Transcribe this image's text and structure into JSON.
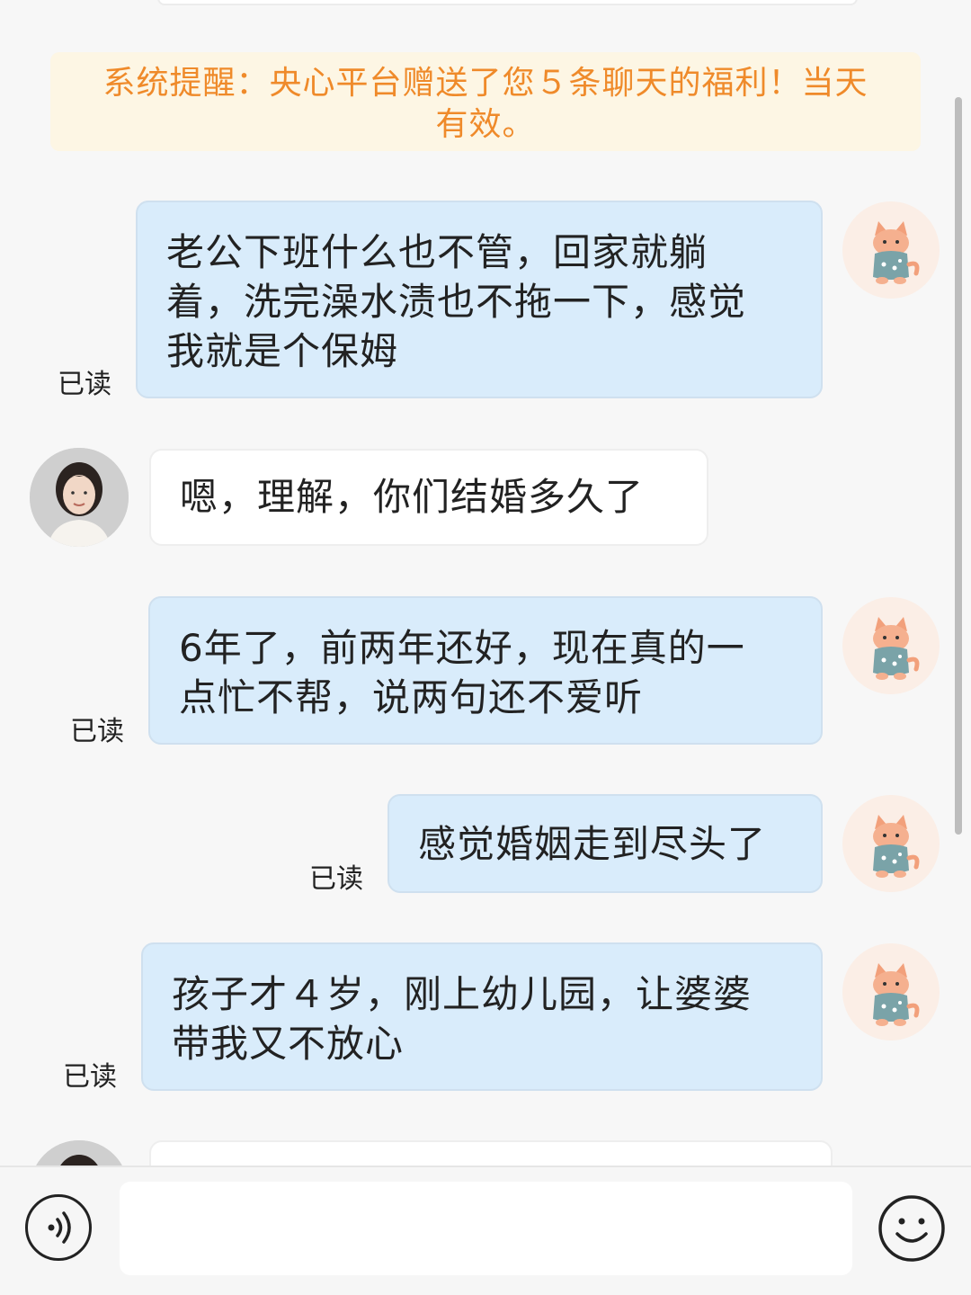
{
  "system_notice": {
    "line1": "系统提醒：央心平台赠送了您５条聊天的福利！当天",
    "line2": "有效。"
  },
  "messages": [
    {
      "from": "me",
      "lines": [
        "老公下班什么也不管，回家就躺",
        "着，洗完澡水渍也不拖一下，感觉",
        "我就是个保姆"
      ],
      "status": "已读"
    },
    {
      "from": "counselor",
      "lines": [
        "嗯，理解，你们结婚多久了"
      ]
    },
    {
      "from": "me",
      "lines": [
        "6年了，前两年还好，现在真的一",
        "点忙不帮，说两句还不爱听"
      ],
      "status": "已读"
    },
    {
      "from": "me",
      "lines": [
        "感觉婚姻走到尽头了"
      ],
      "status": "已读"
    },
    {
      "from": "me",
      "lines": [
        "孩子才４岁，刚上幼儿园，让婆婆",
        "带我又不放心"
      ],
      "status": "已读"
    }
  ],
  "input": {
    "placeholder": "",
    "value": ""
  },
  "icons": {
    "voice": "voice-wave-icon",
    "emoji": "smiley-face-icon",
    "my_avatar": "cat-sweater-avatar",
    "counselor_avatar": "woman-photo-avatar"
  },
  "colors": {
    "notice_text": "#ef8a2a",
    "notice_bg": "#fdf6e4",
    "my_bubble": "#d9ecfb",
    "their_bubble": "#ffffff",
    "background": "#f7f7f7"
  }
}
